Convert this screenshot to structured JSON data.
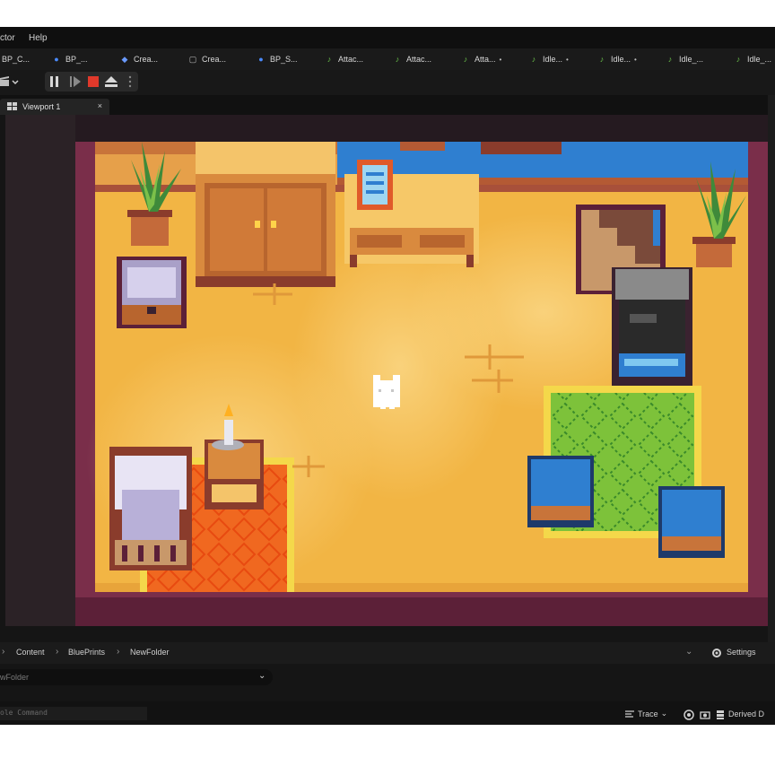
{
  "menu": [
    "ctor",
    "Help"
  ],
  "tabs": [
    {
      "label": "BP_C...",
      "icon": "blueprint-icon",
      "dot": false
    },
    {
      "label": "BP_...",
      "icon": "character-icon",
      "dot": false
    },
    {
      "label": "Crea...",
      "icon": "creature-icon",
      "dot": false
    },
    {
      "label": "Crea...",
      "icon": "flipbook-icon",
      "dot": false
    },
    {
      "label": "BP_S...",
      "icon": "character-icon",
      "dot": false
    },
    {
      "label": "Attac...",
      "icon": "animation-icon",
      "dot": false
    },
    {
      "label": "Attac...",
      "icon": "animation-icon",
      "dot": false
    },
    {
      "label": "Atta...",
      "icon": "animation-icon",
      "dot": true
    },
    {
      "label": "Idle...",
      "icon": "animation-icon",
      "dot": true
    },
    {
      "label": "Idle...",
      "icon": "animation-icon",
      "dot": true
    },
    {
      "label": "Idle_...",
      "icon": "animation-icon",
      "dot": false
    },
    {
      "label": "Idle_...",
      "icon": "animation-icon",
      "dot": false
    }
  ],
  "viewport": {
    "tab_label": "Viewport 1",
    "close": "×"
  },
  "content_browser": {
    "breadcrumbs": [
      "Content",
      "BluePrints",
      "NewFolder"
    ],
    "settings_label": "Settings",
    "path_value": "wFolder"
  },
  "statusbar": {
    "console_placeholder": "ole Command",
    "trace_label": "Trace",
    "derived_label": "Derived D"
  },
  "colors": {
    "floor": "#f2b544",
    "wall": "#7a2e4a",
    "rug_green": "#7dc23a",
    "rug_orange": "#f06820",
    "stop_red": "#e0392b"
  }
}
